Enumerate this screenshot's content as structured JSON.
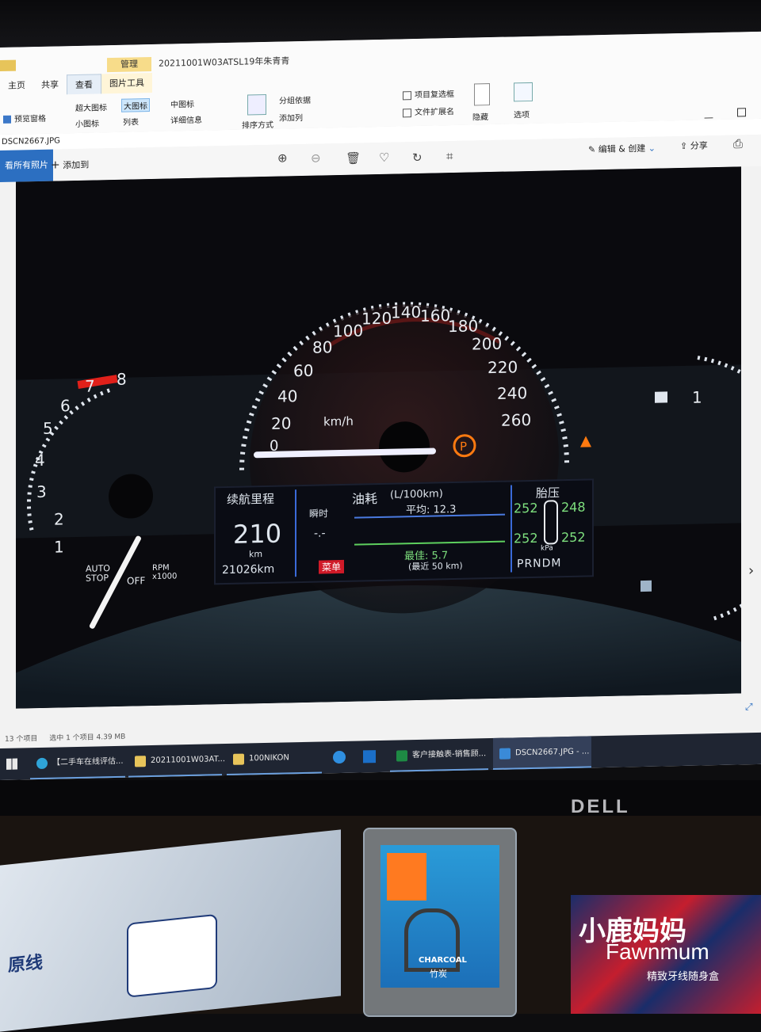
{
  "explorer": {
    "window_title": "20211001W03ATSL19年朱青青",
    "context_tab": "管理",
    "context_sub": "图片工具",
    "tabs": [
      "主页",
      "共享",
      "查看"
    ],
    "view_items": [
      "超大图标",
      "大图标",
      "中图标",
      "小图标",
      "列表",
      "详细信息"
    ],
    "preview_pane": "预览窗格",
    "group_by": "分组依据",
    "add_column": "添加列",
    "sort_by": "排序方式",
    "checkbox_items": [
      "项目复选框",
      "文件扩展名"
    ],
    "hide": "隐藏",
    "options": "选项",
    "path": "DSCN2667.JPG",
    "status_items": "13 个项目",
    "status_selected": "选中 1 个项目  4.39 MB"
  },
  "photos_app": {
    "all_photos": "看所有照片",
    "add_to": "添加到",
    "edit_create": "编辑 & 创建",
    "share": "分享"
  },
  "dashboard": {
    "speed_labels": [
      "0",
      "20",
      "40",
      "60",
      "80",
      "100",
      "120",
      "140",
      "160",
      "180",
      "200",
      "220",
      "240",
      "260"
    ],
    "speed_unit": "km/h",
    "rpm_labels": [
      "1",
      "2",
      "3",
      "4",
      "5",
      "6",
      "7",
      "8"
    ],
    "auto_stop": "AUTO STOP",
    "auto_stop_off": "OFF",
    "rpm_unit": "RPM x1000",
    "range_title": "续航里程",
    "range_value": "210",
    "range_unit": "km",
    "odometer": "21026km",
    "fuel_title": "油耗",
    "fuel_unit": "(L/100km)",
    "instant": "瞬时",
    "instant_value": "-.-",
    "avg_label": "平均: 12.3",
    "best_label": "最佳: 5.7",
    "recent": "(最近 50 km)",
    "menu": "菜单",
    "tire_title": "胎压",
    "tire_fl": "252",
    "tire_fr": "248",
    "tire_rl": "252",
    "tire_rr": "252",
    "tire_unit": "kPa",
    "gear": "PRNDM",
    "gear_right": "1"
  },
  "taskbar": {
    "items": [
      "【二手车在线评估...",
      "20211001W03AT...",
      "100NIKON",
      "客户接触表-销售顾...",
      "DSCN2667.JPG - ..."
    ]
  },
  "monitor_brand": "DELL",
  "desk": {
    "charcoal": "CHARCOAL",
    "zhutan": "竹炭",
    "box_brand_cn": "小鹿妈妈",
    "box_brand_en": "Fawnmum",
    "box_slogan": "精致牙线随身盒",
    "bag_text": "原线"
  }
}
